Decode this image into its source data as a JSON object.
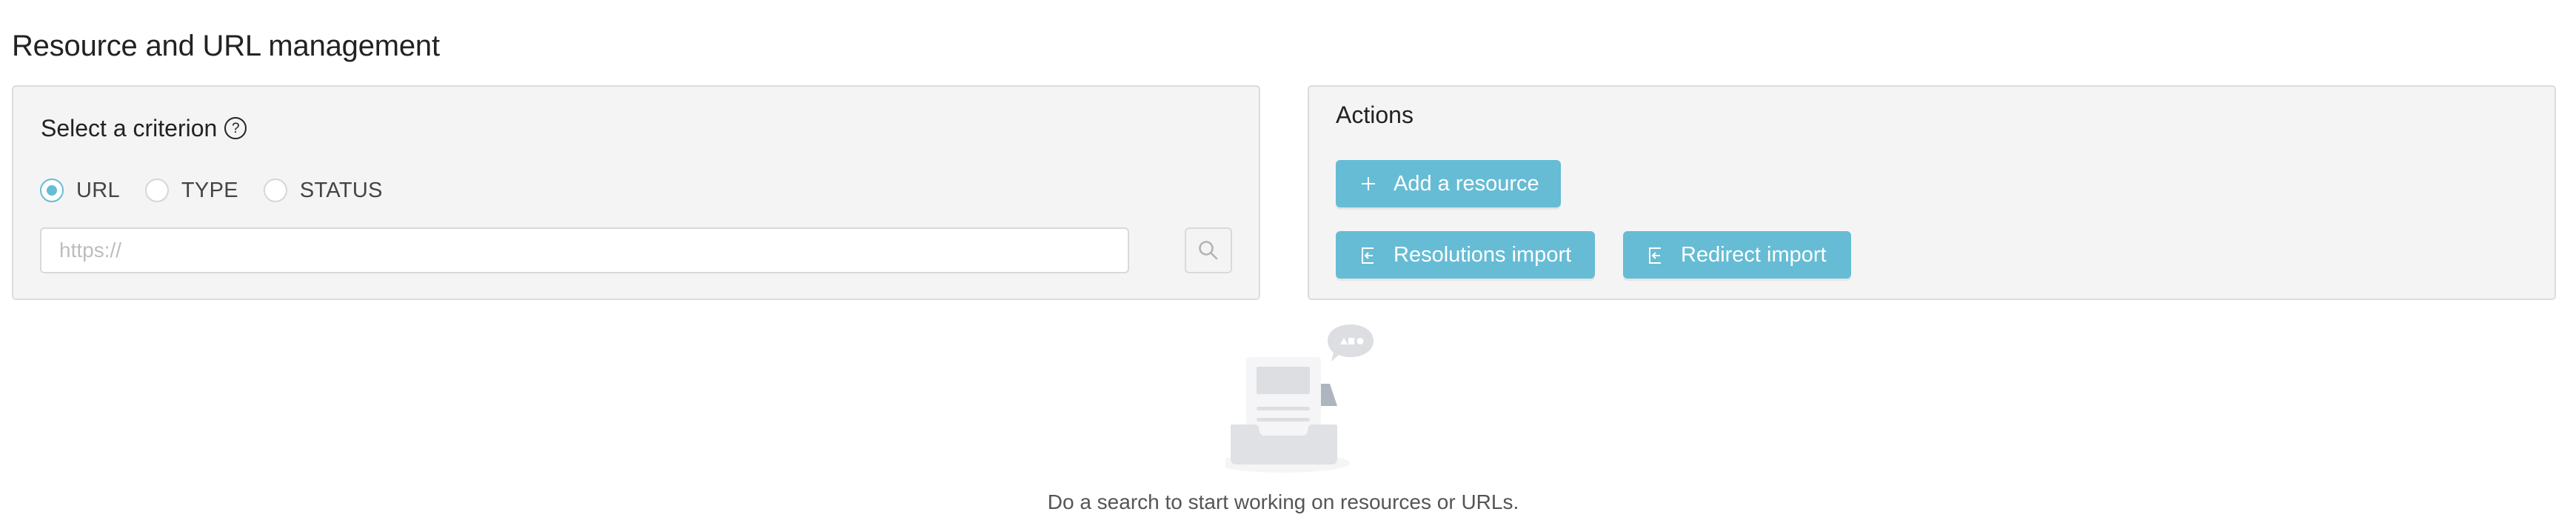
{
  "page": {
    "title": "Resource and URL management"
  },
  "criterion_panel": {
    "title": "Select a criterion",
    "help_icon": "question-circle-icon",
    "help_glyph": "?",
    "radios": [
      {
        "label": "URL",
        "checked": true
      },
      {
        "label": "TYPE",
        "checked": false
      },
      {
        "label": "STATUS",
        "checked": false
      }
    ],
    "search_input": {
      "value": "",
      "placeholder": "https://"
    },
    "search_button_icon": "search-icon"
  },
  "actions_panel": {
    "title": "Actions",
    "buttons": [
      {
        "label": "Add a resource",
        "icon": "plus-icon"
      },
      {
        "label": "Resolutions import",
        "icon": "import-icon"
      },
      {
        "label": "Redirect import",
        "icon": "import-icon"
      }
    ]
  },
  "empty_state": {
    "illustration": "empty-inbox-illustration",
    "message": "Do a search to start working on resources or URLs."
  },
  "colors": {
    "accent": "#66bcd4",
    "panel_background": "#f4f4f4",
    "panel_border": "#dcdcdc",
    "text_primary": "#222222",
    "text_secondary": "#555555",
    "placeholder": "#bdbdbd"
  }
}
